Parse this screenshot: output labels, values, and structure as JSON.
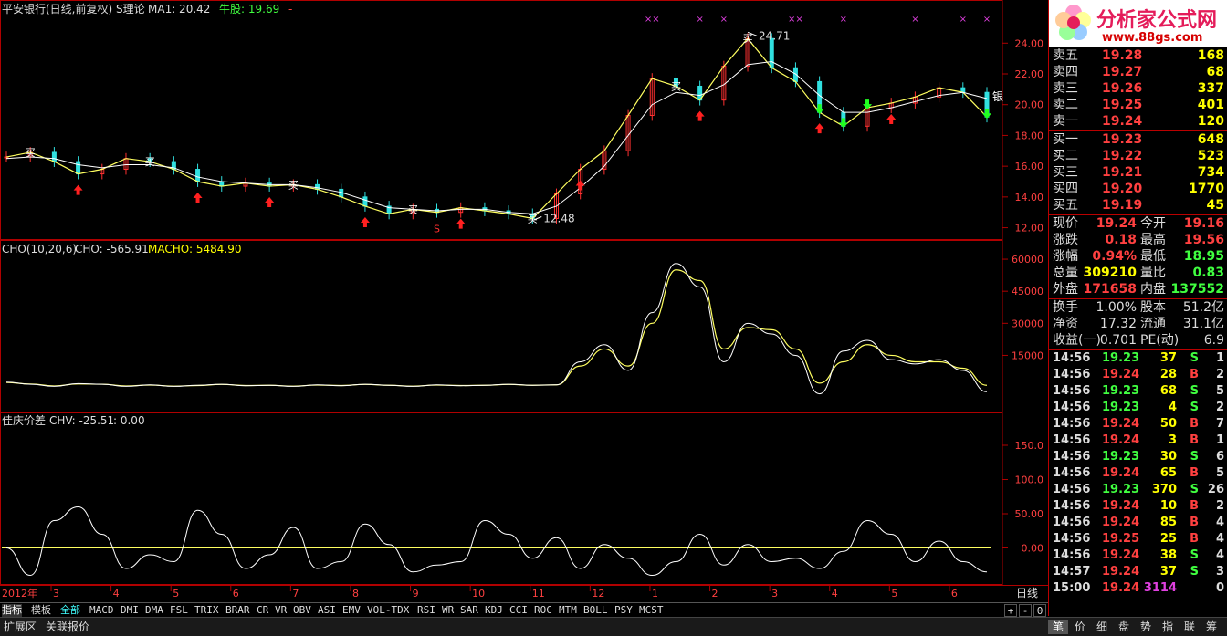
{
  "header": {
    "stock_title": "平安银行(日线,前复权) S理论",
    "ma_label": "MA1: 20.42",
    "bull_label": "牛股: 19.69",
    "bull_suffix": "-"
  },
  "price_axis": [
    "24.00",
    "22.00",
    "20.00",
    "18.00",
    "16.00",
    "14.00",
    "12.00"
  ],
  "cho_axis": [
    "60000",
    "45000",
    "30000",
    "15000"
  ],
  "chv_axis": [
    "150.0",
    "100.0",
    "50.00",
    "0.00"
  ],
  "annotations": {
    "high": "24.71",
    "low": "12.48",
    "buy_marker": "买",
    "silver_marker": "银",
    "s_marker": "S",
    "x_marker": "××",
    "x_single": "×"
  },
  "cho_header": {
    "name": "CHO(10,20,6)",
    "cho": "CHO: -565.91",
    "macho": "MACHO: 5484.90"
  },
  "chv_header": {
    "name": "佳庆价差",
    "chv": "CHV: -25.51",
    "extra": ": 0.00"
  },
  "time_axis": {
    "year": "2012年",
    "months": [
      "3",
      "4",
      "5",
      "6",
      "7",
      "8",
      "9",
      "10",
      "11",
      "12",
      "1",
      "2",
      "3",
      "4",
      "5",
      "6"
    ]
  },
  "period_label": "日线",
  "indicator_tabs": [
    "指标",
    "模板",
    "全部",
    "MACD",
    "DMI",
    "DMA",
    "FSL",
    "TRIX",
    "BRAR",
    "CR",
    "VR",
    "OBV",
    "ASI",
    "EMV",
    "VOL-TDX",
    "RSI",
    "WR",
    "SAR",
    "KDJ",
    "CCI",
    "ROC",
    "MTM",
    "BOLL",
    "PSY",
    "MCST"
  ],
  "zoom_controls": {
    "plus": "+",
    "minus": "-",
    "zero": "0"
  },
  "status_tabs": [
    "扩展区",
    "关联报价"
  ],
  "panel_tabs": [
    "笔",
    "价",
    "细",
    "盘",
    "势",
    "指",
    "联",
    "筹"
  ],
  "logo": {
    "brand": "分析家公式网",
    "url": "www.88gs.com"
  },
  "order_book": {
    "sell": [
      {
        "label": "卖五",
        "price": "19.28",
        "vol": "168"
      },
      {
        "label": "卖四",
        "price": "19.27",
        "vol": "68"
      },
      {
        "label": "卖三",
        "price": "19.26",
        "vol": "337"
      },
      {
        "label": "卖二",
        "price": "19.25",
        "vol": "401"
      },
      {
        "label": "卖一",
        "price": "19.24",
        "vol": "120"
      }
    ],
    "buy": [
      {
        "label": "买一",
        "price": "19.23",
        "vol": "648"
      },
      {
        "label": "买二",
        "price": "19.22",
        "vol": "523"
      },
      {
        "label": "买三",
        "price": "19.21",
        "vol": "734"
      },
      {
        "label": "买四",
        "price": "19.20",
        "vol": "1770"
      },
      {
        "label": "买五",
        "price": "19.19",
        "vol": "45"
      }
    ]
  },
  "quote": [
    {
      "l1": "现价",
      "v1": "19.24",
      "c1": "#ff4040",
      "l2": "今开",
      "v2": "19.16",
      "c2": "#ff4040"
    },
    {
      "l1": "涨跌",
      "v1": "0.18",
      "c1": "#ff4040",
      "l2": "最高",
      "v2": "19.56",
      "c2": "#ff4040"
    },
    {
      "l1": "涨幅",
      "v1": "0.94%",
      "c1": "#ff4040",
      "l2": "最低",
      "v2": "18.95",
      "c2": "#40ff40"
    },
    {
      "l1": "总量",
      "v1": "309210",
      "c1": "#ffff00",
      "l2": "量比",
      "v2": "0.83",
      "c2": "#40ff40"
    },
    {
      "l1": "外盘",
      "v1": "171658",
      "c1": "#ff4040",
      "l2": "内盘",
      "v2": "137552",
      "c2": "#40ff40"
    }
  ],
  "fundamentals": [
    {
      "l1": "换手",
      "v1": "1.00%",
      "l2": "股本",
      "v2": "51.2亿"
    },
    {
      "l1": "净资",
      "v1": "17.32",
      "l2": "流通",
      "v2": "31.1亿"
    },
    {
      "l1": "收益(一)",
      "v1": "0.701",
      "l2": "PE(动)",
      "v2": "6.9"
    }
  ],
  "ticks": [
    {
      "t": "14:56",
      "p": "19.23",
      "v": "37",
      "bs": "S",
      "n": "1"
    },
    {
      "t": "14:56",
      "p": "19.24",
      "v": "28",
      "bs": "B",
      "n": "2"
    },
    {
      "t": "14:56",
      "p": "19.23",
      "v": "68",
      "bs": "S",
      "n": "5"
    },
    {
      "t": "14:56",
      "p": "19.23",
      "v": "4",
      "bs": "S",
      "n": "2"
    },
    {
      "t": "14:56",
      "p": "19.24",
      "v": "50",
      "bs": "B",
      "n": "7"
    },
    {
      "t": "14:56",
      "p": "19.24",
      "v": "3",
      "bs": "B",
      "n": "1"
    },
    {
      "t": "14:56",
      "p": "19.23",
      "v": "30",
      "bs": "S",
      "n": "6"
    },
    {
      "t": "14:56",
      "p": "19.24",
      "v": "65",
      "bs": "B",
      "n": "5"
    },
    {
      "t": "14:56",
      "p": "19.23",
      "v": "370",
      "bs": "S",
      "n": "26"
    },
    {
      "t": "14:56",
      "p": "19.24",
      "v": "10",
      "bs": "B",
      "n": "2"
    },
    {
      "t": "14:56",
      "p": "19.24",
      "v": "85",
      "bs": "B",
      "n": "4"
    },
    {
      "t": "14:56",
      "p": "19.25",
      "v": "25",
      "bs": "B",
      "n": "4"
    },
    {
      "t": "14:56",
      "p": "19.24",
      "v": "38",
      "bs": "S",
      "n": "4"
    },
    {
      "t": "14:57",
      "p": "19.24",
      "v": "37",
      "bs": "S",
      "n": "3"
    },
    {
      "t": "15:00",
      "p": "19.24",
      "v": "3114",
      "bs": "",
      "n": "0"
    }
  ],
  "chart_data": [
    {
      "type": "line",
      "name": "price",
      "ylim": [
        11.5,
        25.5
      ],
      "x": [
        "3",
        "4",
        "5",
        "6",
        "7",
        "8",
        "9",
        "10",
        "11",
        "12",
        "1",
        "2",
        "3",
        "4",
        "5",
        "6"
      ],
      "close": [
        16.6,
        16.9,
        16.3,
        15.5,
        15.8,
        16.5,
        16.3,
        15.8,
        15.0,
        14.7,
        14.9,
        14.7,
        14.8,
        14.5,
        14.0,
        13.4,
        12.9,
        13.2,
        13.0,
        13.3,
        13.1,
        12.9,
        12.6,
        14.2,
        15.8,
        17.0,
        19.3,
        21.7,
        21.2,
        20.3,
        22.5,
        24.3,
        22.4,
        21.5,
        19.5,
        18.6,
        19.8,
        20.1,
        20.5,
        21.1,
        20.8,
        19.2
      ],
      "ma": [
        16.5,
        16.6,
        16.5,
        16.1,
        15.9,
        16.1,
        16.1,
        15.9,
        15.3,
        15.0,
        14.9,
        14.8,
        14.8,
        14.6,
        14.3,
        13.8,
        13.3,
        13.2,
        13.1,
        13.2,
        13.2,
        13.0,
        12.9,
        13.4,
        14.6,
        16.0,
        18.0,
        20.0,
        20.8,
        20.6,
        21.3,
        22.6,
        22.8,
        22.0,
        20.6,
        19.5,
        19.5,
        19.8,
        20.2,
        20.6,
        20.8,
        20.4
      ],
      "high_label": 24.71,
      "low_label": 12.48
    },
    {
      "type": "line",
      "name": "CHO(10,20,6)",
      "ylim": [
        -10000,
        66000
      ],
      "series": [
        {
          "name": "CHO",
          "values": [
            2500,
            1500,
            500,
            1800,
            1500,
            500,
            1200,
            500,
            1000,
            1500,
            800,
            1000,
            500,
            1200,
            800,
            1500,
            1000,
            500,
            1200,
            800,
            1000,
            1500,
            1000,
            1200,
            12000,
            20000,
            8000,
            35000,
            58000,
            47000,
            12000,
            30000,
            25000,
            15000,
            -3000,
            17000,
            22000,
            13000,
            11000,
            13000,
            8000,
            -2000
          ]
        },
        {
          "name": "MACHO",
          "values": [
            2300,
            1600,
            700,
            1600,
            1500,
            700,
            1100,
            600,
            900,
            1400,
            900,
            1000,
            600,
            1100,
            900,
            1400,
            1000,
            600,
            1100,
            900,
            1000,
            1400,
            1000,
            1200,
            10000,
            18000,
            10000,
            30000,
            55000,
            50000,
            18000,
            28000,
            27000,
            18000,
            2000,
            12000,
            20000,
            15000,
            12000,
            12000,
            9000,
            1000
          ]
        }
      ]
    },
    {
      "type": "line",
      "name": "佳庆价差 CHV",
      "ylim": [
        -50,
        190
      ],
      "series": [
        {
          "name": "CHV",
          "values": [
            0,
            -40,
            40,
            60,
            20,
            -30,
            -10,
            -20,
            55,
            20,
            -30,
            -10,
            30,
            -30,
            -20,
            35,
            5,
            -35,
            -25,
            -20,
            40,
            20,
            -15,
            15,
            -30,
            5,
            -15,
            -40,
            -20,
            20,
            -25,
            5,
            -20,
            -15,
            -30,
            -5,
            40,
            20,
            -20,
            10,
            -20,
            -35
          ]
        }
      ]
    }
  ]
}
